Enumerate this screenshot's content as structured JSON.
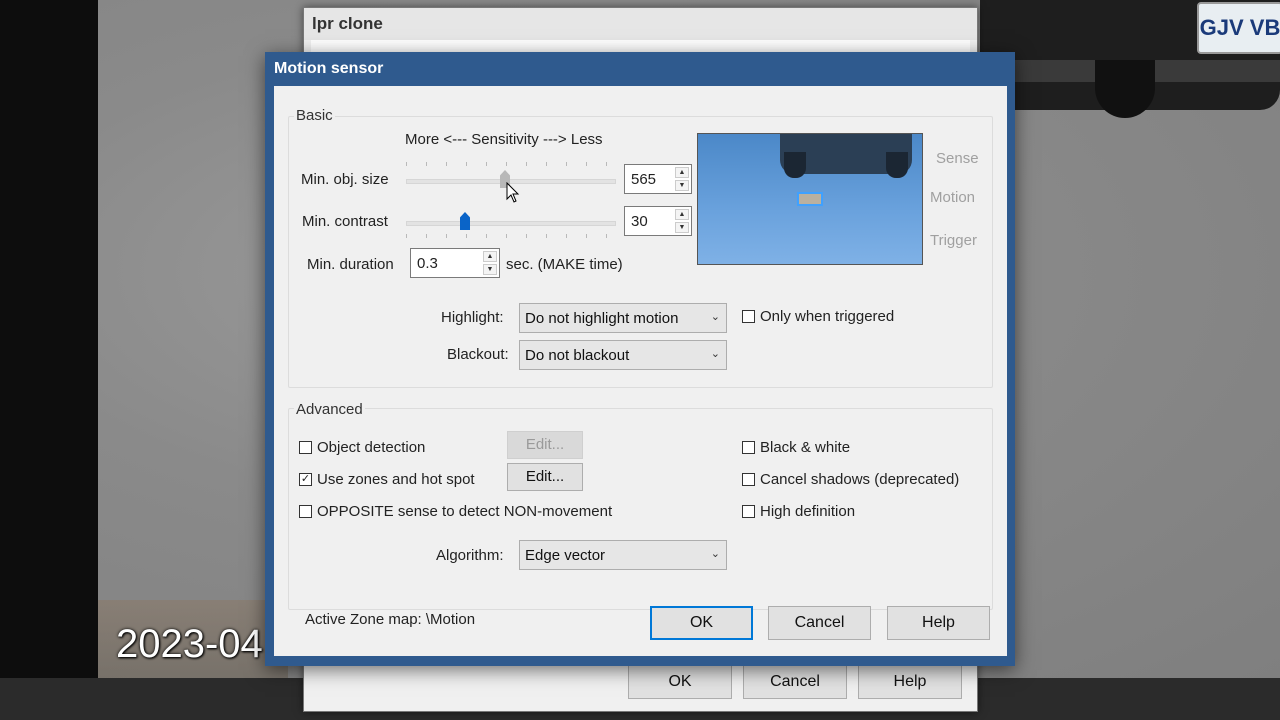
{
  "background": {
    "timestamp": "2023-04",
    "plate_text": "GJV VB"
  },
  "parent_dialog": {
    "title": "lpr clone",
    "ok_label": "OK",
    "cancel_label": "Cancel",
    "help_label": "Help"
  },
  "dialog": {
    "title": "Motion sensor",
    "basic": {
      "group_label": "Basic",
      "sensitivity_caption": "More <--- Sensitivity ---> Less",
      "min_obj_size_label": "Min. obj. size",
      "min_obj_size_value": "565",
      "min_obj_size_slider_fraction": 0.47,
      "min_contrast_label": "Min. contrast",
      "min_contrast_value": "30",
      "min_contrast_slider_fraction": 0.27,
      "min_duration_label": "Min. duration",
      "min_duration_value": "0.3",
      "min_duration_unit": "sec.  (MAKE time)",
      "preview_labels": [
        "Sense",
        "Motion",
        "Trigger"
      ],
      "highlight_label": "Highlight:",
      "highlight_value": "Do not highlight motion",
      "only_when_triggered_label": "Only when triggered",
      "only_when_triggered_checked": false,
      "blackout_label": "Blackout:",
      "blackout_value": "Do not blackout"
    },
    "advanced": {
      "group_label": "Advanced",
      "object_detection_label": "Object detection",
      "object_detection_checked": false,
      "use_zones_label": "Use zones and hot spot",
      "use_zones_checked": true,
      "opposite_sense_label": "OPPOSITE sense to detect NON-movement",
      "opposite_sense_checked": false,
      "edit_label": "Edit...",
      "black_white_label": "Black & white",
      "black_white_checked": false,
      "cancel_shadows_label": "Cancel shadows (deprecated)",
      "cancel_shadows_checked": false,
      "high_definition_label": "High definition",
      "high_definition_checked": false,
      "algorithm_label": "Algorithm:",
      "algorithm_value": "Edge vector"
    },
    "footer": {
      "active_zone_map": "Active Zone map:  \\Motion",
      "ok_label": "OK",
      "cancel_label": "Cancel",
      "help_label": "Help"
    }
  },
  "colors": {
    "title_bar": "#2f5a8e",
    "slider_thumb_active": "#0a64c8",
    "slider_thumb_inactive": "#b8b8b8",
    "default_button_border": "#0078d7"
  }
}
